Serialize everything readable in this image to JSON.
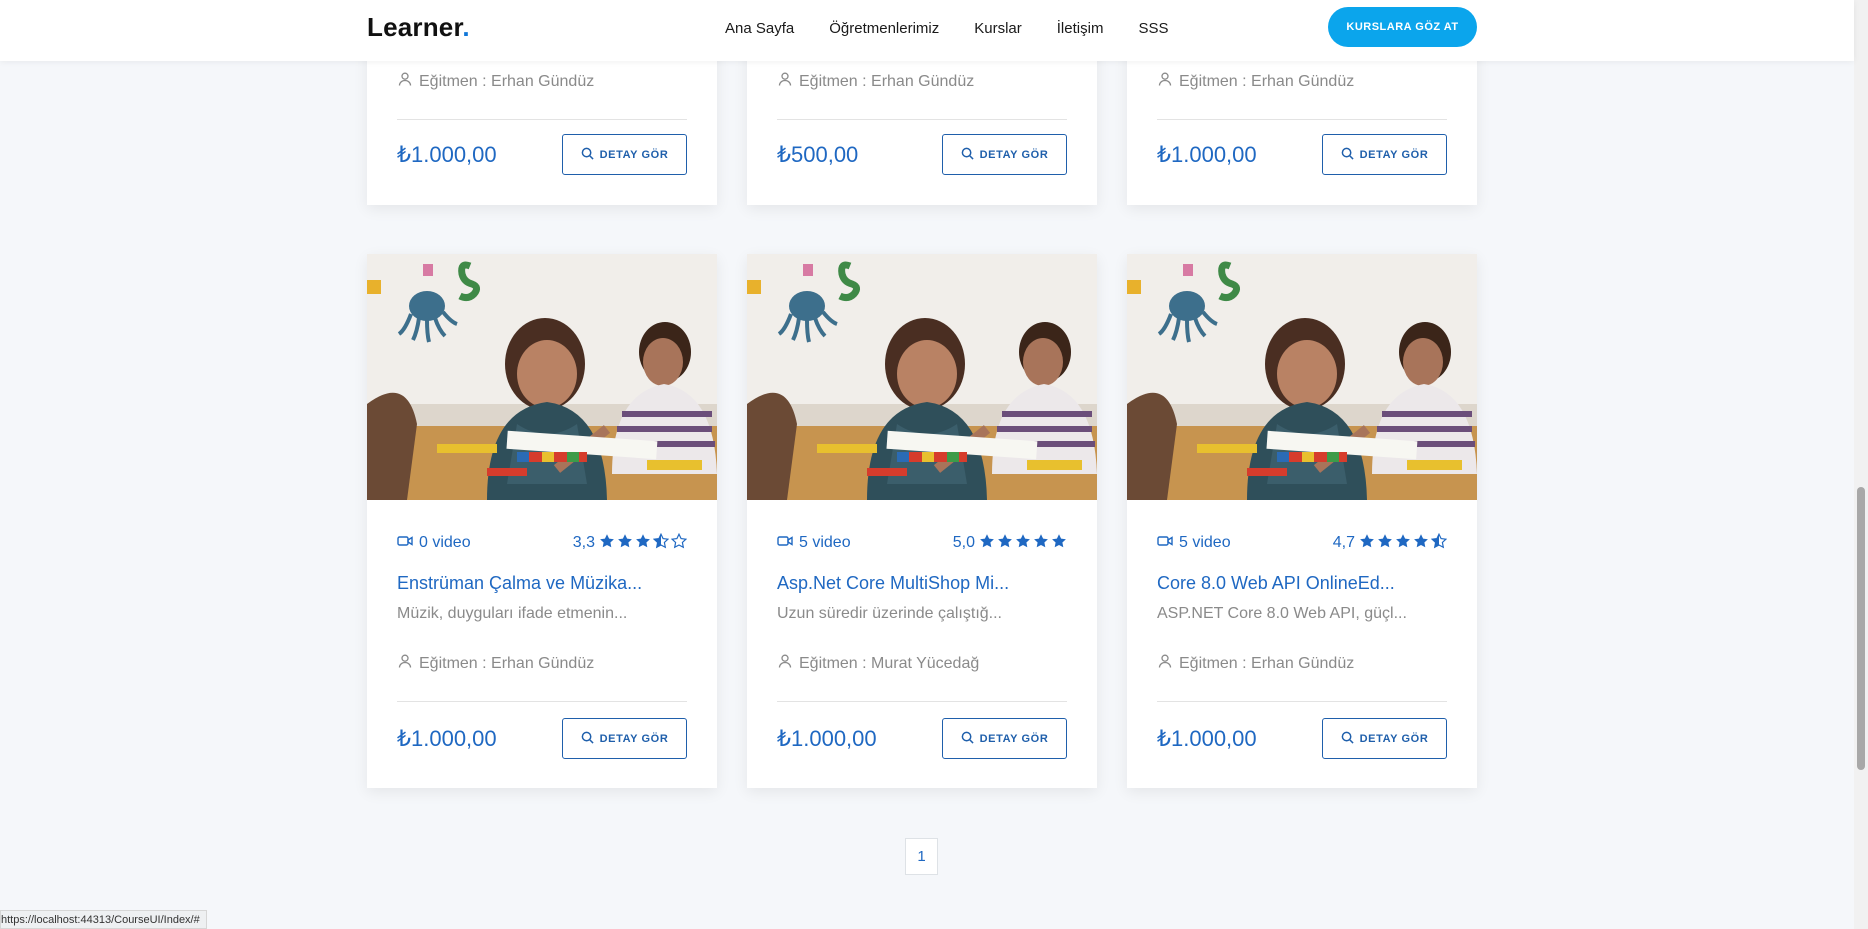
{
  "header": {
    "logo_text": "Learner",
    "logo_dot": ".",
    "nav": [
      "Ana Sayfa",
      "Öğretmenlerimiz",
      "Kurslar",
      "İletişim",
      "SSS"
    ],
    "cta_label": "KURSLARA GÖZ AT",
    "accent_color": "#0ba5ec"
  },
  "top_cards": [
    {
      "instructor": "Eğitmen : Erhan Gündüz",
      "price": "₺1.000,00",
      "button": "DETAY GÖR"
    },
    {
      "instructor": "Eğitmen : Erhan Gündüz",
      "price": "₺500,00",
      "button": "DETAY GÖR"
    },
    {
      "instructor": "Eğitmen : Erhan Gündüz",
      "price": "₺1.000,00",
      "button": "DETAY GÖR"
    }
  ],
  "cards": [
    {
      "videos": "0 video",
      "rating": "3,3",
      "stars": 3.5,
      "title": "Enstrüman Çalma ve Müzika...",
      "description": "Müzik, duyguları ifade etmenin...",
      "instructor": "Eğitmen : Erhan Gündüz",
      "price": "₺1.000,00",
      "button": "DETAY GÖR"
    },
    {
      "videos": "5 video",
      "rating": "5,0",
      "stars": 5,
      "title": "Asp.Net Core MultiShop Mi...",
      "description": "Uzun süredir üzerinde çalıştığ...",
      "instructor": "Eğitmen : Murat Yücedağ",
      "price": "₺1.000,00",
      "button": "DETAY GÖR"
    },
    {
      "videos": "5 video",
      "rating": "4,7",
      "stars": 4.5,
      "title": "Core 8.0 Web API OnlineEd...",
      "description": "ASP.NET Core 8.0 Web API, güçl...",
      "instructor": "Eğitmen : Erhan Gündüz",
      "price": "₺1.000,00",
      "button": "DETAY GÖR"
    }
  ],
  "pagination": {
    "current": "1"
  },
  "status_url": "https://localhost:44313/CourseUI/Index/#",
  "colors": {
    "primary_text": "#1f68c2",
    "button_border": "#1f5fab",
    "muted": "#8a8a8a"
  }
}
